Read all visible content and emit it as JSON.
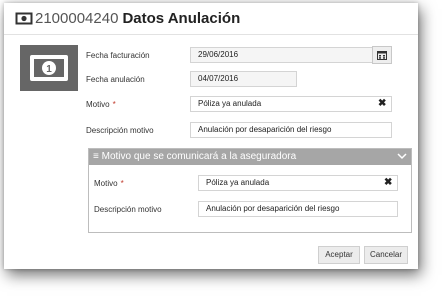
{
  "header": {
    "icon": "money-icon",
    "number": "2100004240",
    "title": "Datos Anulación"
  },
  "thumbnail": {
    "icon": "money-icon"
  },
  "form": {
    "fecha_facturacion": {
      "label": "Fecha facturación",
      "value": "29/06/2016",
      "button_icon": "calendar-icon"
    },
    "fecha_anulacion": {
      "label": "Fecha anulación",
      "value": "04/07/2016"
    },
    "motivo": {
      "label": "Motivo",
      "required_mark": "*",
      "value": "Póliza ya anulada",
      "clear_icon": "close-icon"
    },
    "descripcion": {
      "label": "Descripción motivo",
      "value": "Anulación por desaparición del riesgo"
    }
  },
  "section": {
    "title": "Motivo que se comunicará a la aseguradora",
    "menu_icon": "menu-icon",
    "toggle_icon": "chevron-down-icon",
    "motivo": {
      "label": "Motivo",
      "required_mark": "*",
      "value": "Póliza ya anulada",
      "clear_icon": "close-icon"
    },
    "descripcion": {
      "label": "Descripción motivo",
      "value": "Anulación por desaparición del riesgo"
    }
  },
  "footer": {
    "accept_label": "Aceptar",
    "cancel_label": "Cancelar"
  },
  "colors": {
    "section_header": "#a6a6a6",
    "thumbnail_bg": "#666666",
    "required": "#c0392b"
  }
}
